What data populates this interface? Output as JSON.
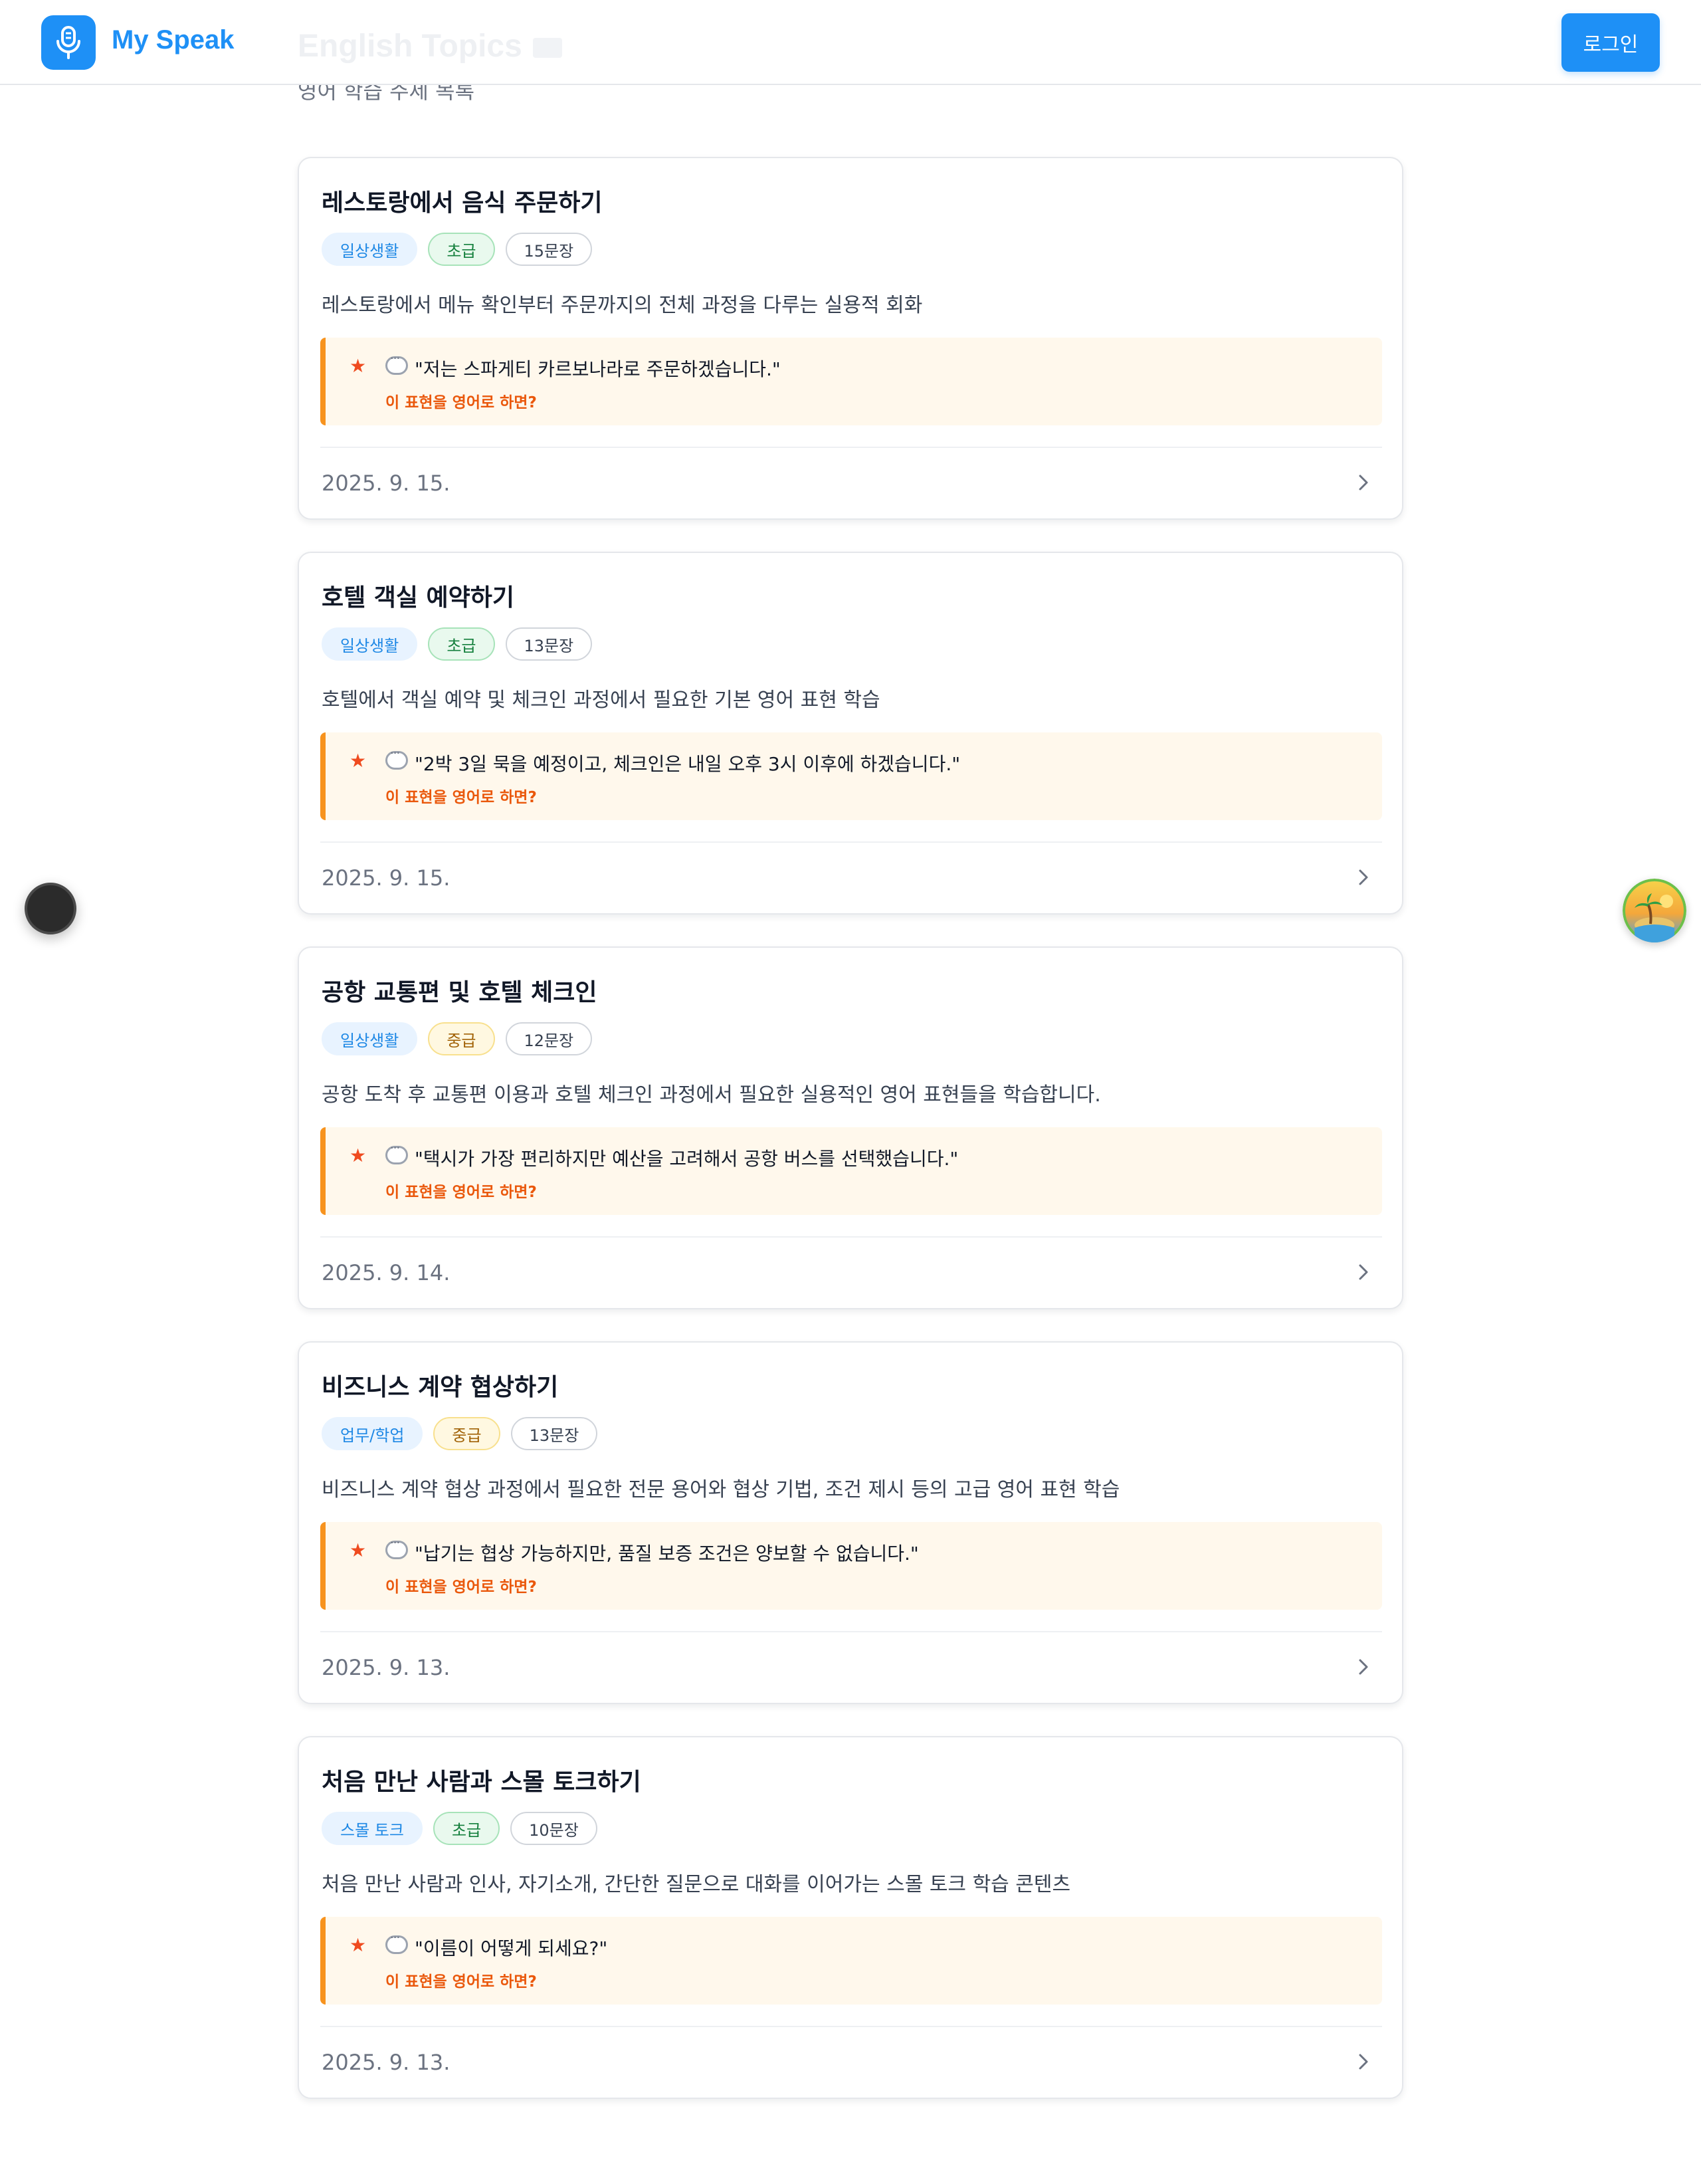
{
  "header": {
    "brand": "My Speak",
    "login_label": "로그인"
  },
  "page": {
    "title": "English Topics",
    "subtitle": "영어 학습 주제 목록"
  },
  "topics": [
    {
      "title": "레스토랑에서 음식 주문하기",
      "category": "일상생활",
      "level": "초급",
      "count": "15문장",
      "description": "레스토랑에서 메뉴 확인부터 주문까지의 전체 과정을 다루는 실용적 회화",
      "quote": "\"저는 스파게티 카르보나라로 주문하겠습니다.\"",
      "hint": "이 표현을 영어로 하면?",
      "date": "2025. 9. 15."
    },
    {
      "title": "호텔 객실 예약하기",
      "category": "일상생활",
      "level": "초급",
      "count": "13문장",
      "description": "호텔에서 객실 예약 및 체크인 과정에서 필요한 기본 영어 표현 학습",
      "quote": "\"2박 3일 묵을 예정이고, 체크인은 내일 오후 3시 이후에 하겠습니다.\"",
      "hint": "이 표현을 영어로 하면?",
      "date": "2025. 9. 15."
    },
    {
      "title": "공항 교통편 및 호텔 체크인",
      "category": "일상생활",
      "level": "중급",
      "count": "12문장",
      "description": "공항 도착 후 교통편 이용과 호텔 체크인 과정에서 필요한 실용적인 영어 표현들을 학습합니다.",
      "quote": "\"택시가 가장 편리하지만 예산을 고려해서 공항 버스를 선택했습니다.\"",
      "hint": "이 표현을 영어로 하면?",
      "date": "2025. 9. 14."
    },
    {
      "title": "비즈니스 계약 협상하기",
      "category": "업무/학업",
      "level": "중급",
      "count": "13문장",
      "description": "비즈니스 계약 협상 과정에서 필요한 전문 용어와 협상 기법, 조건 제시 등의 고급 영어 표현 학습",
      "quote": "\"납기는 협상 가능하지만, 품질 보증 조건은 양보할 수 없습니다.\"",
      "hint": "이 표현을 영어로 하면?",
      "date": "2025. 9. 13."
    },
    {
      "title": "처음 만난 사람과 스몰 토크하기",
      "category": "스몰 토크",
      "level": "초급",
      "count": "10문장",
      "description": "처음 만난 사람과 인사, 자기소개, 간단한 질문으로 대화를 이어가는 스몰 토크 학습 콘텐츠",
      "quote": "\"이름이 어떻게 되세요?\"",
      "hint": "이 표현을 영어로 하면?",
      "date": "2025. 9. 13."
    }
  ],
  "colors": {
    "accent": "#1e90f6",
    "quote_bg": "#fff8ec",
    "quote_border": "#f7931e",
    "hint": "#ea580c"
  },
  "icons": {
    "logo": "microphone-icon",
    "star": "star-icon",
    "bubble": "speech-bubble-icon",
    "chevron": "chevron-right-icon",
    "float_left": "record-button-icon",
    "float_right": "island-avatar-icon"
  }
}
